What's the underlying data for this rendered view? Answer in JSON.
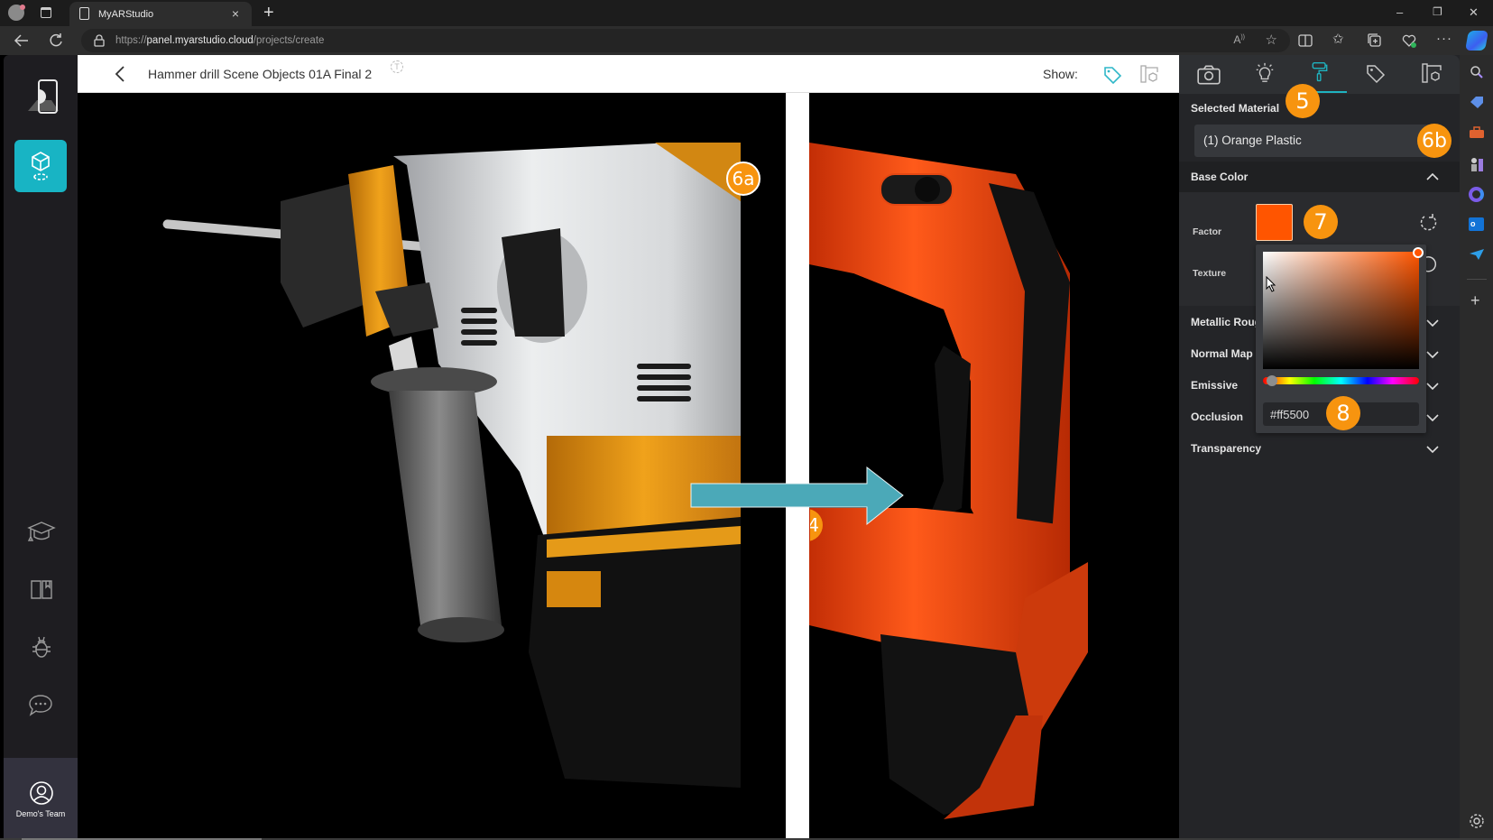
{
  "browser": {
    "tab_title": "MyARStudio",
    "url_prefix": "https://",
    "url_host": "panel.myarstudio.cloud",
    "url_path": "/projects/create",
    "close_glyph": "×",
    "newtab_glyph": "+",
    "window_controls": {
      "minimize": "–",
      "restore": "❐",
      "close": "✕"
    }
  },
  "sidebar": {
    "items": [
      {
        "name": "ar-preview",
        "icon": "phone-ar-icon",
        "active": false
      },
      {
        "name": "3d-objects",
        "icon": "cube-icon",
        "active": true
      },
      {
        "name": "academy",
        "icon": "graduation-cap-icon",
        "active": false
      },
      {
        "name": "docs",
        "icon": "book-icon",
        "active": false
      },
      {
        "name": "bug-report",
        "icon": "bug-icon",
        "active": false
      },
      {
        "name": "chat",
        "icon": "chat-icon",
        "active": false
      }
    ],
    "team_label": "Demo's Team"
  },
  "header": {
    "back_glyph": "‹",
    "title": "Hammer drill Scene Objects 01A Final 2",
    "show_label": "Show:"
  },
  "viewport": {
    "badges": {
      "b6a": "6a",
      "b4": "4"
    },
    "accent": "#4ba9b8"
  },
  "panel": {
    "tabs": [
      {
        "name": "camera",
        "active": false
      },
      {
        "name": "lighting",
        "active": false
      },
      {
        "name": "material",
        "active": true
      },
      {
        "name": "tags",
        "active": false
      },
      {
        "name": "scene",
        "active": false
      }
    ],
    "selected_material_label": "Selected Material",
    "selected_material_value": "(1) Orange Plastic",
    "base_color_label": "Base Color",
    "factor_label": "Factor",
    "texture_label": "Texture",
    "factor_color": "#ff5500",
    "hex_value": "#ff5500",
    "sections": [
      {
        "label": "Metallic Roug"
      },
      {
        "label": "Normal Map"
      },
      {
        "label": "Emissive"
      },
      {
        "label": "Occlusion"
      },
      {
        "label": "Transparency"
      }
    ],
    "hue_position": 0.055
  },
  "annotations": {
    "b5": "5",
    "b6b": "6b",
    "b7": "7",
    "b8": "8",
    "color": "#f7940f"
  }
}
